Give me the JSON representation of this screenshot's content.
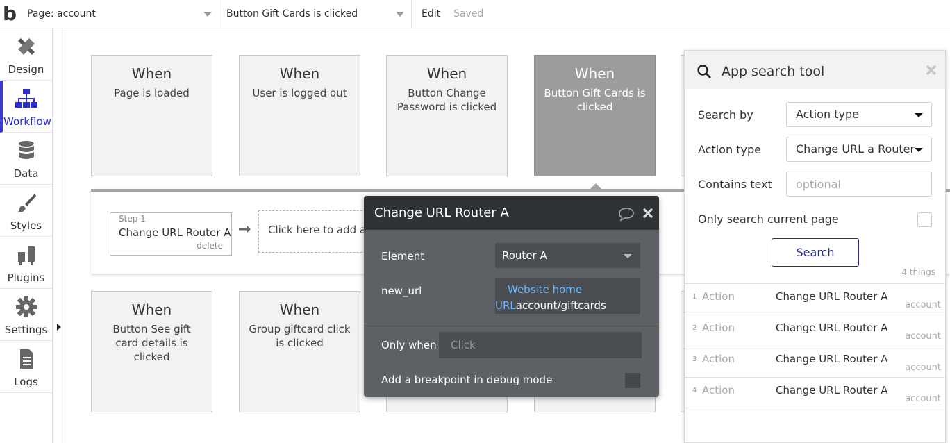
{
  "topbar": {
    "logo": "b",
    "page_dropdown": "Page: account",
    "event_dropdown": "Button Gift Cards is clicked",
    "edit_label": "Edit",
    "saved_label": "Saved"
  },
  "nav": [
    {
      "label": "Design"
    },
    {
      "label": "Workflow"
    },
    {
      "label": "Data"
    },
    {
      "label": "Styles"
    },
    {
      "label": "Plugins"
    },
    {
      "label": "Settings"
    },
    {
      "label": "Logs"
    }
  ],
  "events_top": [
    {
      "when": "When",
      "event": "Page is loaded"
    },
    {
      "when": "When",
      "event": "User is logged out"
    },
    {
      "when": "When",
      "event": "Button Change Password is clicked"
    },
    {
      "when": "When",
      "event": "Button Gift Cards is clicked"
    }
  ],
  "events_bottom": [
    {
      "when": "When",
      "event": "Button See gift card details is clicked"
    },
    {
      "when": "When",
      "event": "Group giftcard click is clicked"
    }
  ],
  "workflow": {
    "step_number": "Step 1",
    "step_action": "Change URL Router A",
    "step_delete": "delete",
    "add_action": "Click here to add an action..."
  },
  "property_editor": {
    "title": "Change URL Router A",
    "element_label": "Element",
    "element_value": "Router A",
    "new_url_label": "new_url",
    "new_url_dynamic_1": "Website home",
    "new_url_dynamic_2": "URL",
    "new_url_static": "account/giftcards",
    "only_when_label": "Only when",
    "only_when_placeholder": "Click",
    "breakpoint_label": "Add a breakpoint in debug mode"
  },
  "search_tool": {
    "title": "App search tool",
    "search_by_label": "Search by",
    "search_by_value": "Action type",
    "action_type_label": "Action type",
    "action_type_value": "Change URL a Router",
    "contains_text_label": "Contains text",
    "contains_text_placeholder": "optional",
    "current_page_label": "Only search current page",
    "search_button": "Search",
    "result_count": "4 things",
    "results": [
      {
        "index": "1",
        "type": "Action",
        "name": "Change URL Router A",
        "page": "account"
      },
      {
        "index": "2",
        "type": "Action",
        "name": "Change URL Router A",
        "page": "account"
      },
      {
        "index": "3",
        "type": "Action",
        "name": "Change URL Router A",
        "page": "account"
      },
      {
        "index": "4",
        "type": "Action",
        "name": "Change URL Router A",
        "page": "account"
      }
    ]
  },
  "colors": {
    "accent": "#2d2dcc",
    "editor_bg": "#5d6064",
    "editor_header": "#2f3336",
    "selected_card": "#9c9c9c",
    "dynamic_text": "#6cb7ff"
  },
  "icons": [
    "design-icon",
    "workflow-icon",
    "data-icon",
    "styles-icon",
    "plugins-icon",
    "settings-icon",
    "logs-icon",
    "search-icon",
    "close-icon",
    "comment-icon",
    "arrow-right-icon"
  ]
}
